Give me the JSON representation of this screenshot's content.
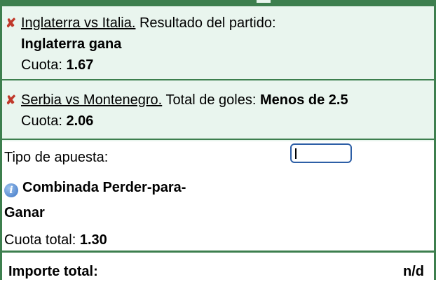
{
  "selections": [
    {
      "match": "Inglaterra vs Italia.",
      "market": "Resultado del partido:",
      "pick": "Inglaterra gana",
      "odds_label": "Cuota:",
      "odds_value": "1.67"
    },
    {
      "match": "Serbia vs Montenegro.",
      "market": "Total de goles:",
      "pick": "Menos de 2.5",
      "odds_label": "Cuota:",
      "odds_value": "2.06"
    }
  ],
  "remove_icon": "✘",
  "bet_type": {
    "label": "Tipo de apuesta:",
    "name_line1": "Combinada Perder-para-",
    "name_line2": "Ganar",
    "info_icon": "i",
    "total_odds_label": "Cuota total:",
    "total_odds_value": "1.30",
    "stake_value": ""
  },
  "total": {
    "label": "Importe total:",
    "value": "n/d"
  },
  "colors": {
    "accent": "#3d7f4e",
    "panel_bg": "#e9f5ee",
    "remove": "#c0392b",
    "input_border": "#2d5fa6"
  }
}
